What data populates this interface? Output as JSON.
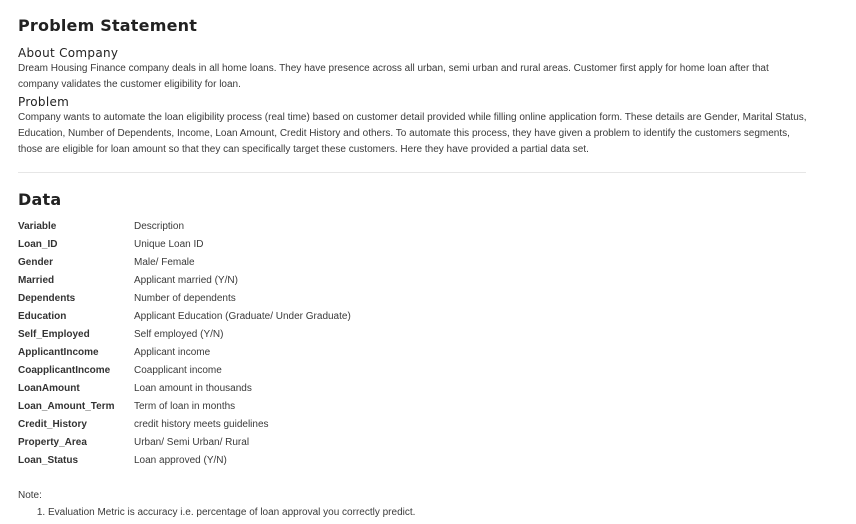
{
  "problem_statement": {
    "title": "Problem Statement",
    "about_heading": "About Company",
    "about_text": "Dream Housing Finance company deals in all home loans. They have presence across all urban, semi urban and rural areas. Customer first apply for home loan after that company validates the customer eligibility for loan.",
    "problem_heading": "Problem",
    "problem_text": "Company wants to automate the loan eligibility process (real time) based on customer detail provided while filling online application form. These details are Gender, Marital Status, Education, Number of Dependents, Income, Loan Amount, Credit History and others. To automate this process, they have given a problem to identify the customers segments, those are eligible for loan amount so that they can specifically target these customers. Here they have provided a partial data set."
  },
  "data_section": {
    "title": "Data",
    "header": {
      "variable": "Variable",
      "description": "Description"
    },
    "rows": [
      {
        "variable": "Loan_ID",
        "description": "Unique Loan ID"
      },
      {
        "variable": "Gender",
        "description": "Male/ Female"
      },
      {
        "variable": "Married",
        "description": "Applicant married (Y/N)"
      },
      {
        "variable": "Dependents",
        "description": "Number of dependents"
      },
      {
        "variable": "Education",
        "description": "Applicant Education (Graduate/ Under Graduate)"
      },
      {
        "variable": "Self_Employed",
        "description": "Self employed (Y/N)"
      },
      {
        "variable": "ApplicantIncome",
        "description": "Applicant income"
      },
      {
        "variable": "CoapplicantIncome",
        "description": "Coapplicant income"
      },
      {
        "variable": "LoanAmount",
        "description": "Loan amount in thousands"
      },
      {
        "variable": "Loan_Amount_Term",
        "description": "Term of loan in months"
      },
      {
        "variable": "Credit_History",
        "description": "credit history meets guidelines"
      },
      {
        "variable": "Property_Area",
        "description": "Urban/ Semi Urban/ Rural"
      },
      {
        "variable": "Loan_Status",
        "description": "Loan approved (Y/N)"
      }
    ]
  },
  "note": {
    "label": "Note:",
    "items": [
      "Evaluation Metric is accuracy i.e. percentage of loan approval you correctly predict."
    ]
  }
}
